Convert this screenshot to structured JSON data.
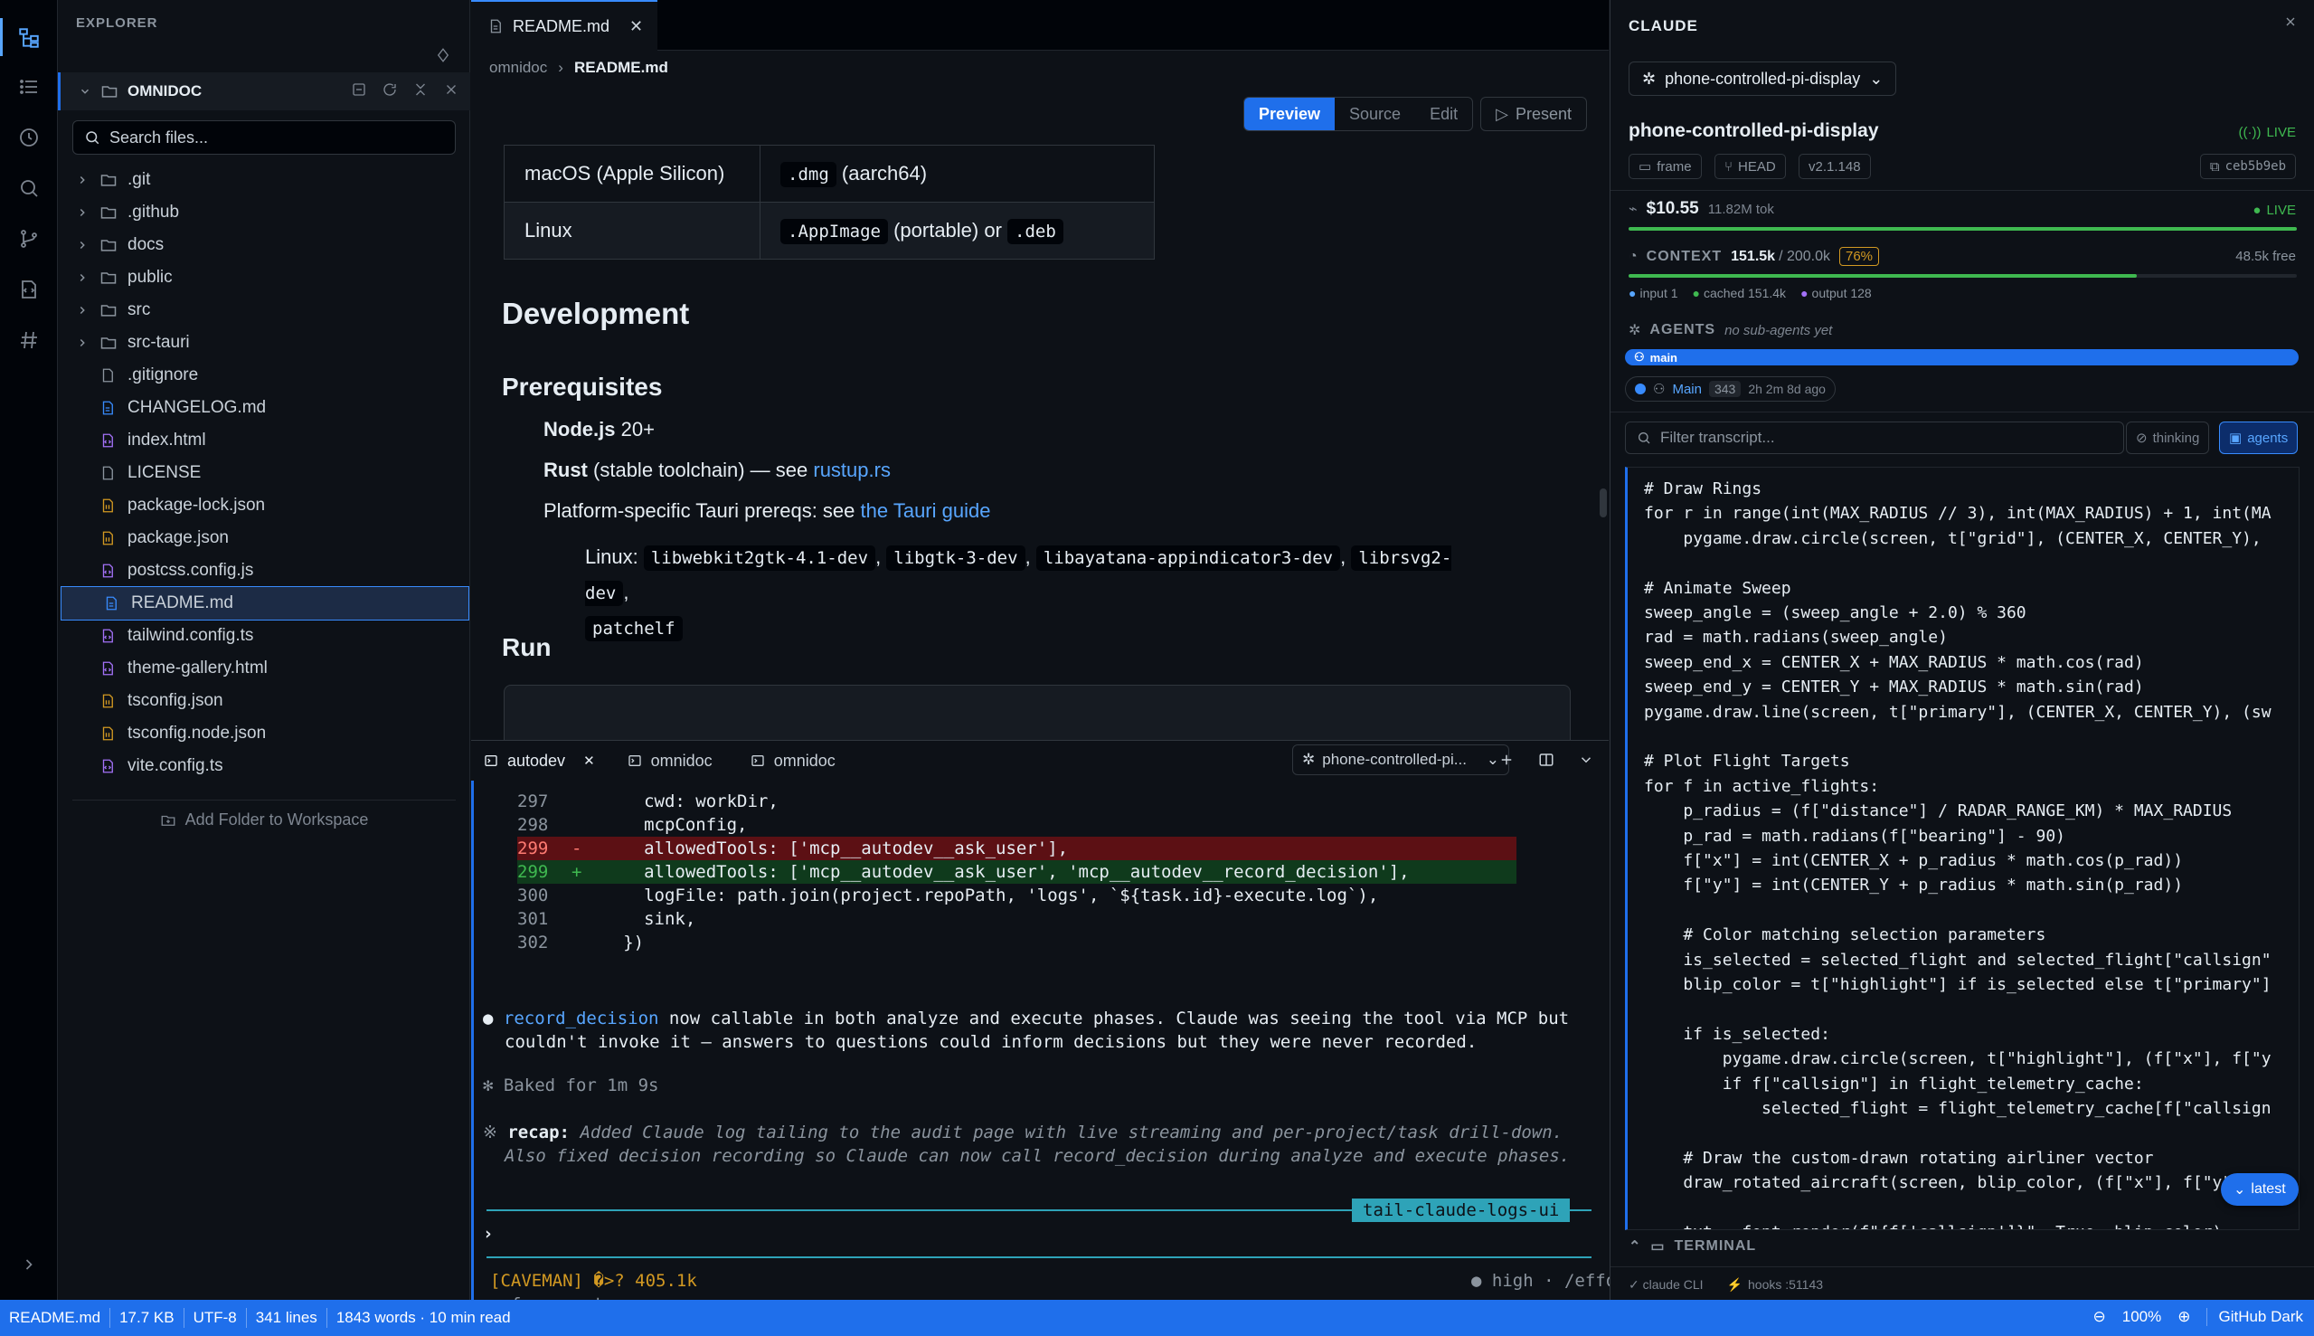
{
  "explorer": {
    "title": "EXPLORER",
    "workspace": "OMNIDOC",
    "search_placeholder": "Search files...",
    "items": [
      {
        "name": ".git",
        "type": "folder"
      },
      {
        "name": ".github",
        "type": "folder"
      },
      {
        "name": "docs",
        "type": "folder"
      },
      {
        "name": "public",
        "type": "folder"
      },
      {
        "name": "src",
        "type": "folder"
      },
      {
        "name": "src-tauri",
        "type": "folder"
      },
      {
        "name": ".gitignore",
        "type": "file"
      },
      {
        "name": "CHANGELOG.md",
        "type": "md"
      },
      {
        "name": "index.html",
        "type": "code"
      },
      {
        "name": "LICENSE",
        "type": "file"
      },
      {
        "name": "package-lock.json",
        "type": "json"
      },
      {
        "name": "package.json",
        "type": "json"
      },
      {
        "name": "postcss.config.js",
        "type": "code"
      },
      {
        "name": "README.md",
        "type": "md",
        "selected": true
      },
      {
        "name": "tailwind.config.ts",
        "type": "code"
      },
      {
        "name": "theme-gallery.html",
        "type": "code"
      },
      {
        "name": "tsconfig.json",
        "type": "json"
      },
      {
        "name": "tsconfig.node.json",
        "type": "json"
      },
      {
        "name": "vite.config.ts",
        "type": "code"
      }
    ],
    "add_folder": "Add Folder to Workspace"
  },
  "editor": {
    "tab": "README.md",
    "breadcrumb": [
      "omnidoc",
      "README.md"
    ],
    "modes": [
      "Preview",
      "Source",
      "Edit"
    ],
    "active_mode": "Preview",
    "present": "Present",
    "table": [
      {
        "platform": "macOS (Apple Silicon)",
        "code1": ".dmg",
        "rest1": "(aarch64)",
        "mid": "",
        "code2": ""
      },
      {
        "platform": "Linux",
        "code1": ".AppImage",
        "rest1": "(portable) or",
        "mid": "",
        "code2": ".deb"
      }
    ],
    "h_development": "Development",
    "h_prereq": "Prerequisites",
    "node_b": "Node.js",
    "node_rest": "20+",
    "rust_b": "Rust",
    "rust_rest": "(stable toolchain) — see",
    "rust_link": "rustup.rs",
    "tauri_text": "Platform-specific Tauri prereqs: see",
    "tauri_link": "the Tauri guide",
    "linux_label": "Linux:",
    "linux_pkgs": [
      "libwebkit2gtk-4.1-dev",
      "libgtk-3-dev",
      "libayatana-appindicator3-dev",
      "librsvg2-dev",
      "patchelf"
    ],
    "h_run": "Run"
  },
  "terminal": {
    "tabs": [
      "autodev",
      "omnidoc",
      "omnidoc"
    ],
    "selector": "phone-controlled-pi...",
    "diff": [
      {
        "n": "297",
        "sign": " ",
        "kind": "ctx",
        "code": "      cwd: workDir,"
      },
      {
        "n": "298",
        "sign": " ",
        "kind": "ctx",
        "code": "      mcpConfig,"
      },
      {
        "n": "299",
        "sign": "-",
        "kind": "del",
        "code": "      allowedTools: ['mcp__autodev__ask_user'],"
      },
      {
        "n": "299",
        "sign": "+",
        "kind": "add",
        "code": "      allowedTools: ['mcp__autodev__ask_user', 'mcp__autodev__record_decision'],"
      },
      {
        "n": "300",
        "sign": " ",
        "kind": "ctx",
        "code": "      logFile: path.join(project.repoPath, 'logs', `${task.id}-execute.log`),"
      },
      {
        "n": "301",
        "sign": " ",
        "kind": "ctx",
        "code": "      sink,"
      },
      {
        "n": "302",
        "sign": " ",
        "kind": "ctx",
        "code": "    })"
      }
    ],
    "msg_code": "record_decision",
    "msg_line1": " now callable in both analyze and execute phases. Claude was seeing the tool via MCP but",
    "msg_line2": "couldn't invoke it — answers to questions could inform decisions but they were never recorded.",
    "baked": "Baked for 1m 9s",
    "recap_label": "recap:",
    "recap_line1": " Added Claude log tailing to the audit page with live streaming and per-project/task drill-down.",
    "recap_line2": "Also fixed decision recording so Claude can now call record_decision during analyze and execute phases.",
    "branch": "tail-claude-logs-ui",
    "prompt": "›",
    "caveman": "[CAVEMAN] �>? 405.1k",
    "effort": "● high · /effort",
    "agents_hint": "← for agents"
  },
  "claude": {
    "title": "CLAUDE",
    "session": "phone-controlled-pi-display",
    "project": "phone-controlled-pi-display",
    "live": "LIVE",
    "pills": [
      "frame",
      "HEAD",
      "v2.1.148"
    ],
    "commit": "ceb5b9eb",
    "cost": "$10.55",
    "tokens": "11.82M tok",
    "cost_live": "LIVE",
    "cost_progress": 1.0,
    "context_label": "CONTEXT",
    "context_used": "151.5k",
    "context_total": "/ 200.0k",
    "context_pct": "76%",
    "context_fraction": 0.76,
    "context_free": "48.5k free",
    "legend": [
      "input 1",
      "cached 151.4k",
      "output 128"
    ],
    "agents_label": "AGENTS",
    "agents_none": "no sub-agents yet",
    "agent_bar": "main",
    "agent_name": "Main",
    "agent_count": "343",
    "agent_meta": "2h 2m 8d ago",
    "filter_placeholder": "Filter transcript...",
    "btn_thinking": "thinking",
    "btn_agents": "agents",
    "code": [
      "# Draw Rings",
      "for r in range(int(MAX_RADIUS // 3), int(MAX_RADIUS) + 1, int(MA",
      "    pygame.draw.circle(screen, t[\"grid\"], (CENTER_X, CENTER_Y),",
      "",
      "# Animate Sweep",
      "sweep_angle = (sweep_angle + 2.0) % 360",
      "rad = math.radians(sweep_angle)",
      "sweep_end_x = CENTER_X + MAX_RADIUS * math.cos(rad)",
      "sweep_end_y = CENTER_Y + MAX_RADIUS * math.sin(rad)",
      "pygame.draw.line(screen, t[\"primary\"], (CENTER_X, CENTER_Y), (sw",
      "",
      "# Plot Flight Targets",
      "for f in active_flights:",
      "    p_radius = (f[\"distance\"] / RADAR_RANGE_KM) * MAX_RADIUS",
      "    p_rad = math.radians(f[\"bearing\"] - 90)",
      "    f[\"x\"] = int(CENTER_X + p_radius * math.cos(p_rad))",
      "    f[\"y\"] = int(CENTER_Y + p_radius * math.sin(p_rad))",
      "",
      "    # Color matching selection parameters",
      "    is_selected = selected_flight and selected_flight[\"callsign\"",
      "    blip_color = t[\"highlight\"] if is_selected else t[\"primary\"]",
      "",
      "    if is_selected:",
      "        pygame.draw.circle(screen, t[\"highlight\"], (f[\"x\"], f[\"y",
      "        if f[\"callsign\"] in flight_telemetry_cache:",
      "            selected_flight = flight_telemetry_cache[f[\"callsign",
      "",
      "    # Draw the custom-drawn rotating airliner vector",
      "    draw_rotated_aircraft(screen, blip_color, (f[\"x\"], f[\"y\"]",
      "",
      "    txt = font.render(f\"{f['callsign']}\", True, blip_color)"
    ],
    "latest": "latest",
    "terminal_label": "TERMINAL",
    "footer": [
      "claude CLI",
      "hooks :51143"
    ]
  },
  "status": {
    "file": "README.md",
    "size": "17.7 KB",
    "encoding": "UTF-8",
    "lines": "341 lines",
    "words": "1843 words · 10 min read",
    "zoom": "100%",
    "theme": "GitHub Dark"
  },
  "colors": {
    "accent": "#1f6feb",
    "live": "#3fb950",
    "warning": "#d29922",
    "background": "#0d1117"
  }
}
